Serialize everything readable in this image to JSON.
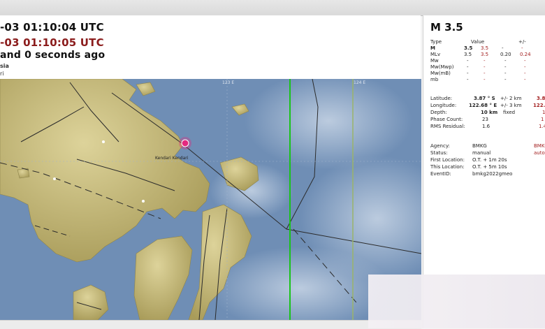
{
  "event_header": {
    "origin_time": "-03 01:10:04 UTC",
    "received_time": "-03 01:10:05 UTC",
    "elapsed": " and 0 seconds ago",
    "region_line": "sia",
    "sub_line": "ri"
  },
  "map": {
    "labels": {
      "lon_123": "123 E",
      "lon_124": "124 E",
      "city": "Kendari Kendari"
    },
    "colors": {
      "sea": "#6f8eb5",
      "land": "#c9bd7a",
      "epicenter": "#e4287f",
      "green_line": "#19c419"
    }
  },
  "magnitude": {
    "title": "M 3.5",
    "headers": {
      "type": "Type",
      "value": "Value",
      "plusminus": "+/-"
    },
    "rows": [
      {
        "type": "M",
        "v1": "3.5",
        "v2": "3.5",
        "pm1": "-",
        "pm2": "-"
      },
      {
        "type": "MLv",
        "v1": "3.5",
        "v2": "3.5",
        "pm1": "0.20",
        "pm2": "0.24"
      },
      {
        "type": "Mw",
        "v1": "-",
        "v2": "-",
        "pm1": "-",
        "pm2": "-"
      },
      {
        "type": "Mw(Mwp)",
        "v1": "-",
        "v2": "-",
        "pm1": "-",
        "pm2": "-"
      },
      {
        "type": "Mw(mB)",
        "v1": "-",
        "v2": "-",
        "pm1": "-",
        "pm2": "-"
      },
      {
        "type": "mb",
        "v1": "-",
        "v2": "-",
        "pm1": "-",
        "pm2": "-"
      }
    ]
  },
  "location": {
    "latitude": {
      "label": "Latitude:",
      "value": "3.87 ° S",
      "pm": "+/-",
      "err": "2 km",
      "other": "3.8"
    },
    "longitude": {
      "label": "Longitude:",
      "value": "122.68 ° E",
      "pm": "+/-",
      "err": "3 km",
      "other": "122.5"
    },
    "depth": {
      "label": "Depth:",
      "value": "10 km",
      "note": "fixed",
      "other": "1"
    },
    "phase_count": {
      "label": "Phase Count:",
      "value": "23",
      "other": "1"
    },
    "rms": {
      "label": "RMS Residual:",
      "value": "1.6",
      "other": "1.4"
    }
  },
  "info": {
    "agency": {
      "label": "Agency:",
      "value": "BMKG",
      "other": "BMKG"
    },
    "status": {
      "label": "Status:",
      "value": "manual",
      "other": "autom"
    },
    "first_location": {
      "label": "First Location:",
      "value": "O.T. + 1m 20s"
    },
    "this_location": {
      "label": "This Location:",
      "value": "O.T. + 5m 10s"
    },
    "event_id": {
      "label": "EventID:",
      "value": "bmkg2022gmeo"
    }
  }
}
